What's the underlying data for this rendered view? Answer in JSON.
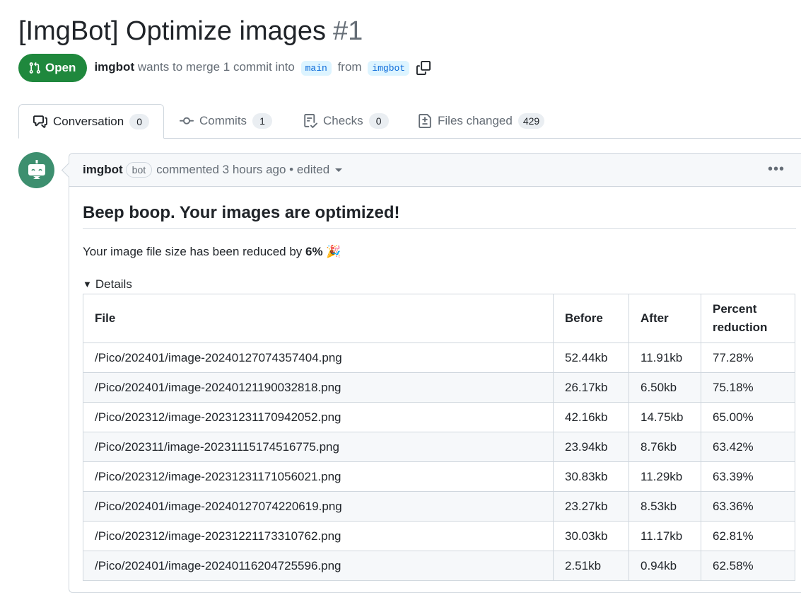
{
  "header": {
    "title": "[ImgBot] Optimize images",
    "number": "#1",
    "state": "Open",
    "author": "imgbot",
    "merge_text": "wants to merge 1 commit into",
    "base_branch": "main",
    "from_text": "from",
    "head_branch": "imgbot"
  },
  "tabs": [
    {
      "label": "Conversation",
      "count": "0",
      "icon": "comment-discussion-icon",
      "active": true
    },
    {
      "label": "Commits",
      "count": "1",
      "icon": "git-commit-icon"
    },
    {
      "label": "Checks",
      "count": "0",
      "icon": "checklist-icon"
    },
    {
      "label": "Files changed",
      "count": "429",
      "icon": "file-diff-icon"
    }
  ],
  "comment": {
    "author": "imgbot",
    "bot_label": "bot",
    "meta": "commented 3 hours ago • edited",
    "heading": "Beep boop. Your images are optimized!",
    "summary_prefix": "Your image file size has been reduced by",
    "summary_value": "6%",
    "summary_emoji": "🎉",
    "details_label": "Details",
    "table": {
      "headers": [
        "File",
        "Before",
        "After",
        "Percent reduction"
      ],
      "rows": [
        [
          "/Pico/202401/image-20240127074357404.png",
          "52.44kb",
          "11.91kb",
          "77.28%"
        ],
        [
          "/Pico/202401/image-20240121190032818.png",
          "26.17kb",
          "6.50kb",
          "75.18%"
        ],
        [
          "/Pico/202312/image-20231231170942052.png",
          "42.16kb",
          "14.75kb",
          "65.00%"
        ],
        [
          "/Pico/202311/image-20231115174516775.png",
          "23.94kb",
          "8.76kb",
          "63.42%"
        ],
        [
          "/Pico/202312/image-20231231171056021.png",
          "30.83kb",
          "11.29kb",
          "63.39%"
        ],
        [
          "/Pico/202401/image-20240127074220619.png",
          "23.27kb",
          "8.53kb",
          "63.36%"
        ],
        [
          "/Pico/202312/image-20231221173310762.png",
          "30.03kb",
          "11.17kb",
          "62.81%"
        ],
        [
          "/Pico/202401/image-20240116204725596.png",
          "2.51kb",
          "0.94kb",
          "62.58%"
        ]
      ]
    }
  },
  "colors": {
    "open_green": "#1f883d",
    "link_blue": "#0969da",
    "branch_bg": "#ddf4ff",
    "avatar_bg": "#3d8f6f"
  }
}
